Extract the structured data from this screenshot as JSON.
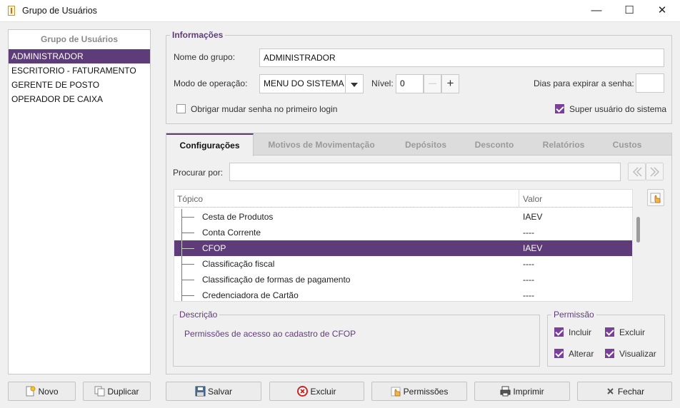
{
  "window": {
    "title": "Grupo de Usuários",
    "controls": {
      "minimize": "—",
      "maximize": "☐",
      "close": "✕"
    }
  },
  "left": {
    "header": "Grupo de Usuários",
    "items": [
      {
        "label": "ADMINISTRADOR",
        "selected": true
      },
      {
        "label": "ESCRITORIO - FATURAMENTO"
      },
      {
        "label": "GERENTE DE POSTO"
      },
      {
        "label": "OPERADOR DE CAIXA"
      }
    ],
    "buttons": {
      "new": "Novo",
      "duplicate": "Duplicar"
    }
  },
  "info": {
    "legend": "Informações",
    "name_label": "Nome do grupo:",
    "name_value": "ADMINISTRADOR",
    "mode_label": "Modo de operação:",
    "mode_value": "MENU DO SISTEMA",
    "level_label": "Nível:",
    "level_value": "0",
    "minus": "—",
    "plus": "+",
    "expire_label": "Dias para expirar a senha:",
    "expire_value": "",
    "force_change_label": "Obrigar mudar senha no primeiro login",
    "force_change_checked": false,
    "super_user_label": "Super usuário do sistema",
    "super_user_checked": true
  },
  "tabs": [
    {
      "label": "Configurações",
      "active": true
    },
    {
      "label": "Motivos de Movimentação"
    },
    {
      "label": "Depósitos"
    },
    {
      "label": "Desconto"
    },
    {
      "label": "Relatórios"
    },
    {
      "label": "Custos"
    }
  ],
  "search": {
    "label": "Procurar por:",
    "value": ""
  },
  "grid": {
    "columns": [
      "Tópico",
      "Valor"
    ],
    "rows": [
      {
        "topic": "Cesta de Produtos",
        "value": "IAEV"
      },
      {
        "topic": "Conta Corrente",
        "value": "----"
      },
      {
        "topic": "CFOP",
        "value": "IAEV",
        "selected": true
      },
      {
        "topic": "Classificação fiscal",
        "value": "----"
      },
      {
        "topic": "Classificação de formas de pagamento",
        "value": "----"
      },
      {
        "topic": "Credenciadora de Cartão",
        "value": "----"
      }
    ]
  },
  "description": {
    "legend": "Descrição",
    "text": "Permissões de acesso ao cadastro de CFOP"
  },
  "permission": {
    "legend": "Permissão",
    "include": "Incluir",
    "delete": "Excluir",
    "edit": "Alterar",
    "view": "Visualizar"
  },
  "footer": {
    "save": "Salvar",
    "delete": "Excluir",
    "permissions": "Permissões",
    "print": "Imprimir",
    "close": "Fechar"
  },
  "colors": {
    "accent": "#5e3c7a",
    "checkbox": "#7a3f9a"
  }
}
